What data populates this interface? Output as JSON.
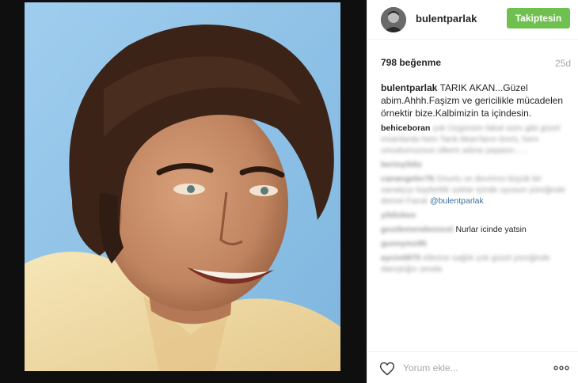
{
  "post": {
    "username": "bulentparlak",
    "follow_label": "Takiptesin",
    "likes": "798 beğenme",
    "age": "25d"
  },
  "caption": {
    "author": "bulentparlak",
    "text": "TARIK AKAN...Güzel abim.Ahhh.Faşizm ve gericilikle mücadelen örnektir bize.Kalbimizin ta içindesin."
  },
  "comments": [
    {
      "user": "behiceboran",
      "text": "çok Üzgünüm fakat sizin gibi güzel insanlarda hem Tarık Akan'ların ömrü, hem umudumuzsun ülkem adına yaşasın......"
    },
    {
      "user": "berinyildiz",
      "text": ""
    },
    {
      "user": "canangeler76",
      "text": "Onurlu ve devrimci büyük bir sanatçıyı kaybettik ışıklar içinde uyusun yüreğinde demet Faruk",
      "tag": "@bulentparlak"
    },
    {
      "user": "yildizkeo",
      "text": ""
    },
    {
      "user": "gozdemendeoncel",
      "text": "Nurlar icinde yatsin"
    },
    {
      "user": "gunnymz95",
      "text": ""
    },
    {
      "user": "aycin0875",
      "text": "ellerine sağlık çok güzel yüreğinde danıştığın sevda"
    }
  ],
  "footer": {
    "comment_placeholder": "Yorum ekle...",
    "more_label": "..."
  },
  "colors": {
    "follow_green": "#70c050",
    "secondary_text": "#a5a7aa",
    "photo_background": "#8cc0e6"
  }
}
